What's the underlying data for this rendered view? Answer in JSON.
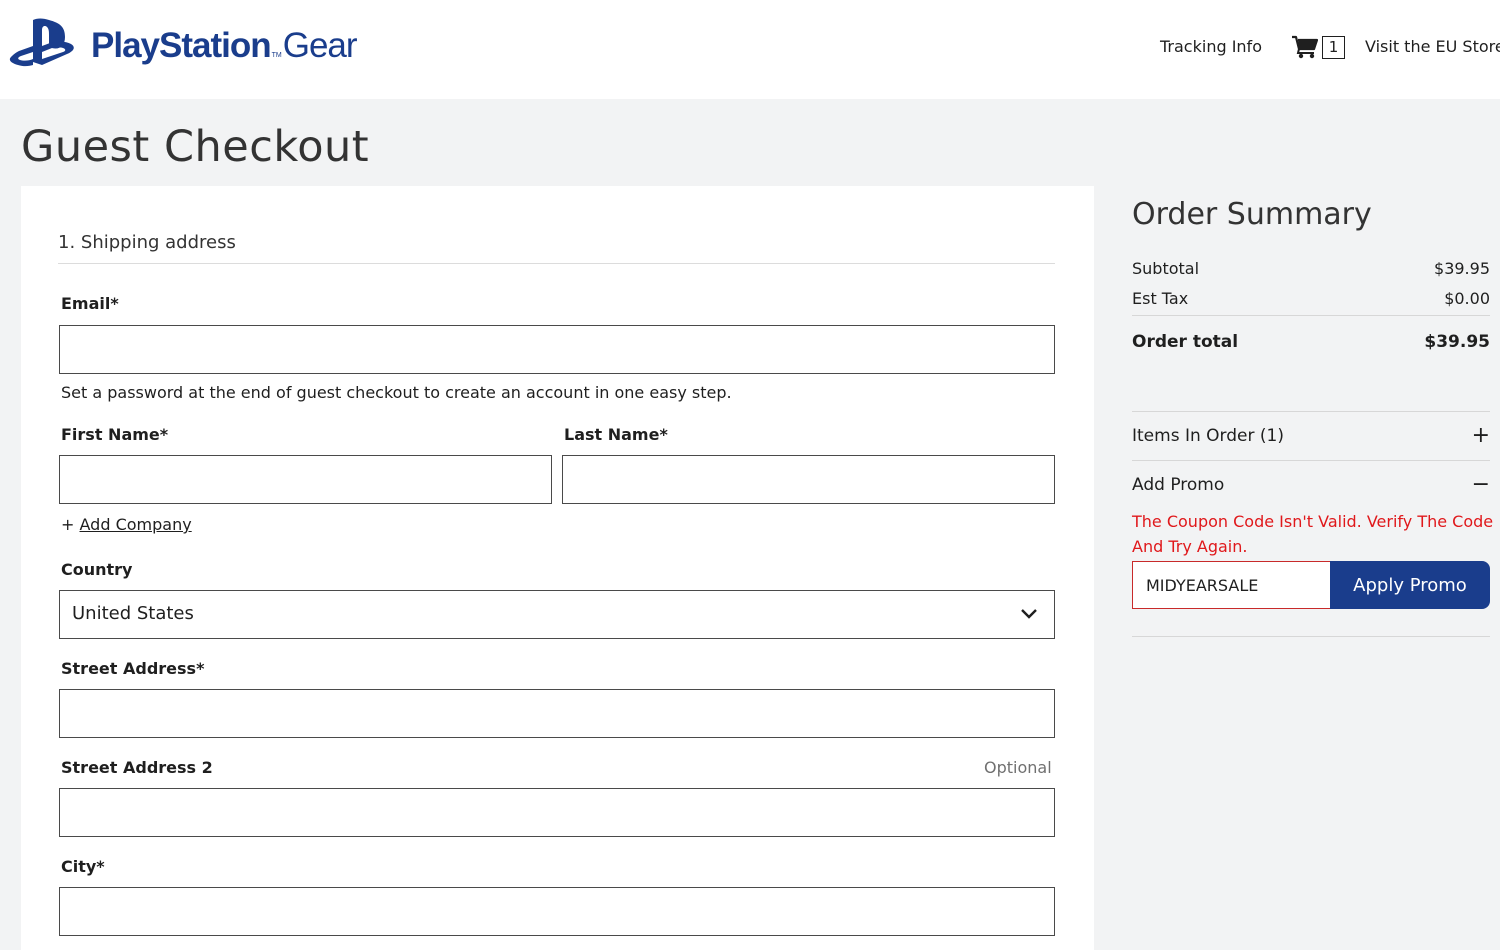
{
  "header": {
    "brand_main": "PlayStation",
    "brand_tm": "TM",
    "brand_sub": "Gear",
    "tracking_label": "Tracking Info",
    "cart_count": "1",
    "eu_store_label": "Visit the EU Store"
  },
  "page": {
    "title": "Guest Checkout"
  },
  "form": {
    "section_title": "1. Shipping address",
    "email_label": "Email*",
    "email_value": "",
    "password_hint": "Set a password at the end of guest checkout to create an account in one easy step.",
    "first_name_label": "First Name*",
    "first_name_value": "",
    "last_name_label": "Last Name*",
    "last_name_value": "",
    "add_company_prefix": "+",
    "add_company_label": "Add Company",
    "country_label": "Country",
    "country_value": "United States",
    "street_label": "Street Address*",
    "street_value": "",
    "street2_label": "Street Address 2",
    "street2_optional": "Optional",
    "street2_value": "",
    "city_label": "City*",
    "city_value": ""
  },
  "summary": {
    "title": "Order Summary",
    "subtotal_label": "Subtotal",
    "subtotal_value": "$39.95",
    "tax_label": "Est Tax",
    "tax_value": "$0.00",
    "total_label": "Order total",
    "total_value": "$39.95",
    "items_label": "Items In Order (1)",
    "items_toggle": "+",
    "promo_label": "Add Promo",
    "promo_toggle": "−",
    "promo_error": "The Coupon Code Isn't Valid. Verify The Code And Try Again.",
    "promo_value": "MIDYEARSALE",
    "promo_button": "Apply Promo"
  },
  "icons": {
    "logo": "playstation-logo-icon",
    "cart": "cart-icon",
    "chevron": "chevron-down-icon"
  },
  "colors": {
    "brand_blue": "#1a3d8c",
    "error_red": "#e0181b",
    "page_bg": "#f2f3f4"
  }
}
